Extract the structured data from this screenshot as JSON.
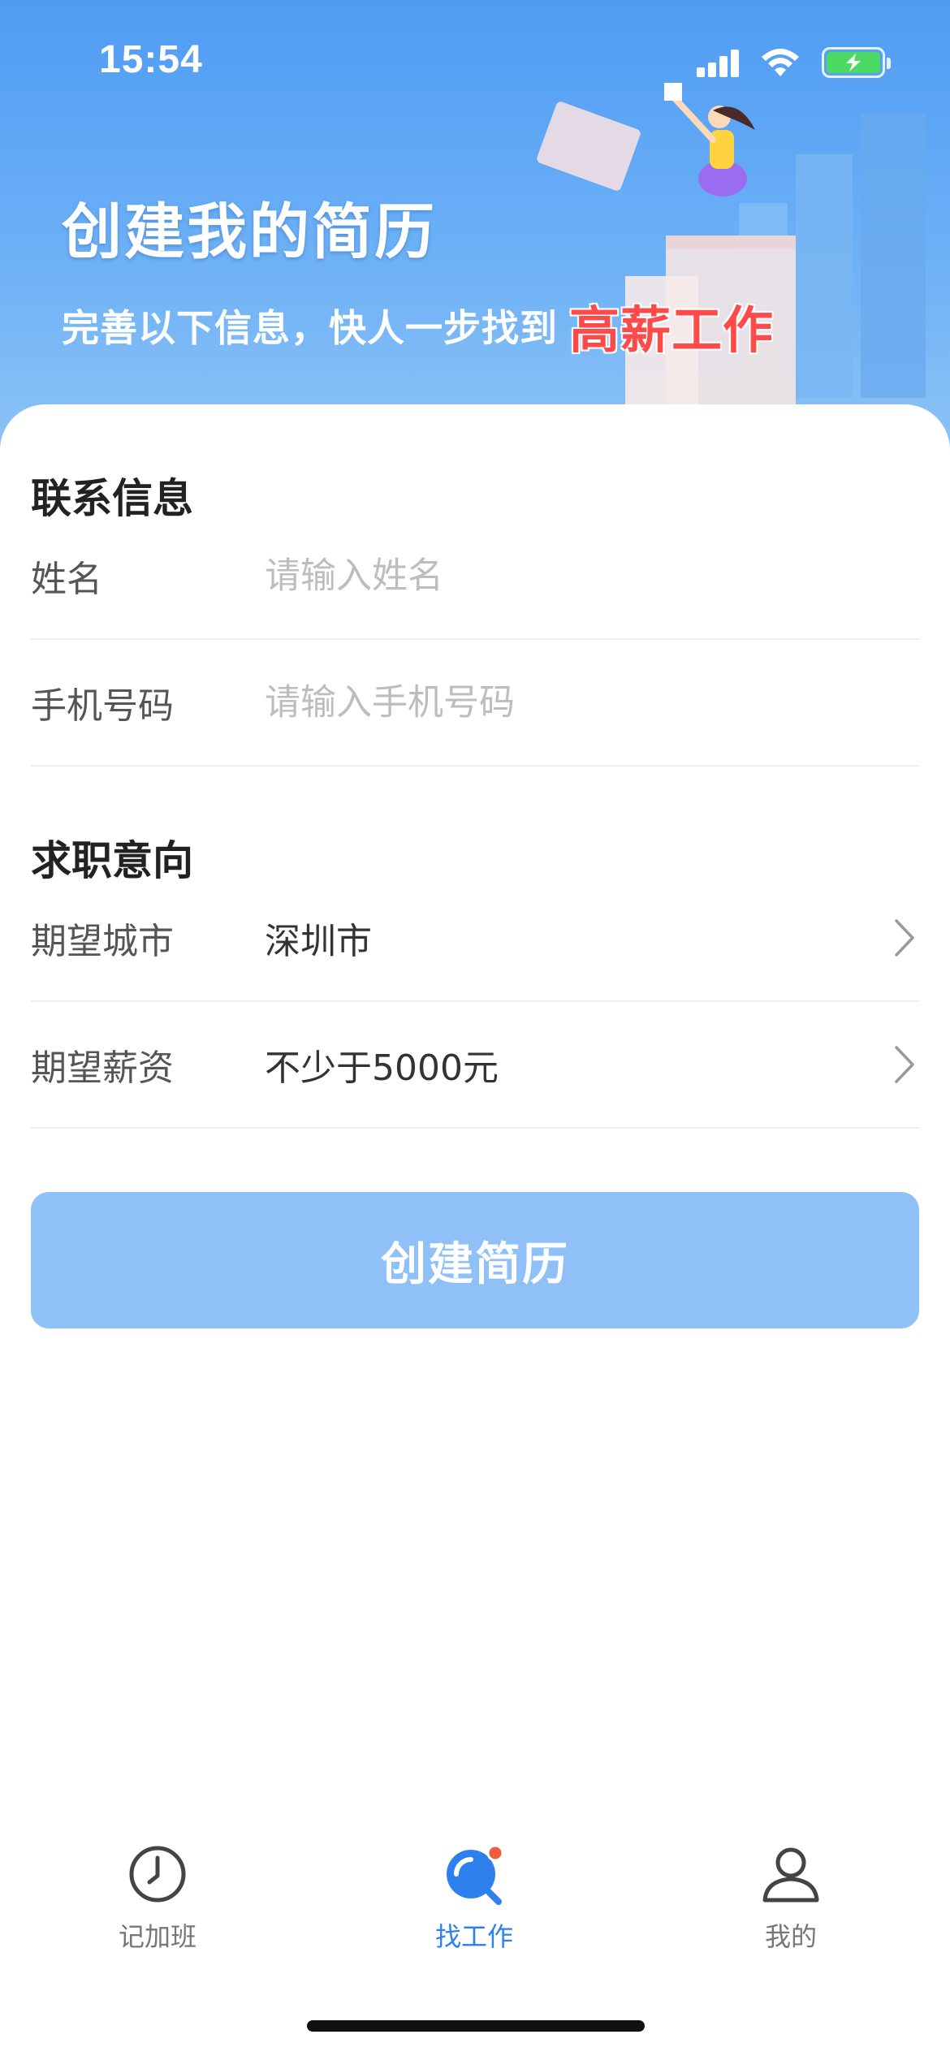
{
  "status_bar": {
    "time": "15:54",
    "icons": [
      "signal-icon",
      "wifi-icon",
      "battery-charging-icon"
    ]
  },
  "banner": {
    "title": "创建我的简历",
    "subtitle": "完善以下信息，快人一步找到",
    "highlight": "高薪工作"
  },
  "contact_section": {
    "title": "联系信息",
    "name_label": "姓名",
    "name_placeholder": "请输入姓名",
    "phone_label": "手机号码",
    "phone_placeholder": "请输入手机号码"
  },
  "intent_section": {
    "title": "求职意向",
    "city_label": "期望城市",
    "city_value": "深圳市",
    "salary_label": "期望薪资",
    "salary_value": "不少于5000元"
  },
  "submit_label": "创建简历",
  "tabbar": {
    "items": [
      {
        "label": "记加班",
        "icon": "clock-icon",
        "active": false
      },
      {
        "label": "找工作",
        "icon": "search-job-icon",
        "active": true
      },
      {
        "label": "我的",
        "icon": "user-icon",
        "active": false
      }
    ]
  },
  "colors": {
    "primary": "#2f80ed",
    "button_disabled": "#8fc0f7",
    "highlight_red": "#ff4a4a",
    "banner_top": "#4f9cf4"
  }
}
